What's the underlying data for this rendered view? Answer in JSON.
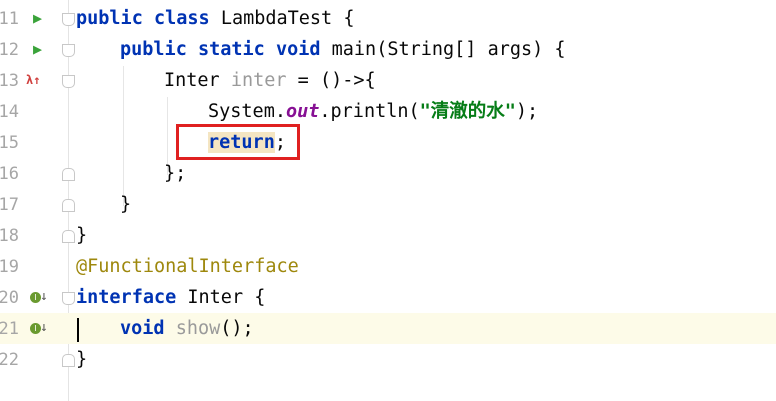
{
  "editor": {
    "lines": [
      {
        "num": "11",
        "text": "public class LambdaTest {"
      },
      {
        "num": "12",
        "text": "public static void main(String[] args) {"
      },
      {
        "num": "13",
        "text": "Inter inter = ()->{"
      },
      {
        "num": "14",
        "text": "System.out.println(\"清澈的水\");"
      },
      {
        "num": "15",
        "text": "return;"
      },
      {
        "num": "16",
        "text": "};"
      },
      {
        "num": "17",
        "text": "}"
      },
      {
        "num": "18",
        "text": "}"
      },
      {
        "num": "19",
        "text": "@FunctionalInterface"
      },
      {
        "num": "20",
        "text": "interface Inter {"
      },
      {
        "num": "21",
        "text": "void show();"
      },
      {
        "num": "22",
        "text": "}"
      }
    ],
    "tokens": {
      "public": "public",
      "class": "class",
      "static": "static",
      "void": "void",
      "interface": "interface",
      "return": "return",
      "lambdatest": "LambdaTest",
      "main": "main",
      "string_args": "(String[] args)",
      "inter_type": "Inter",
      "inter_var": "inter",
      "lambda": " = ()->{",
      "system": "System.",
      "out": "out",
      "println": ".println(",
      "str": "\"清澈的水\"",
      "close_call": ");",
      "anno": "@FunctionalInterface",
      "show": "show",
      "show_parens": "();",
      "brace_open": " {",
      "brace_close": "}",
      "lambda_close": "};",
      "semicolon": ";"
    },
    "gutter_icons": {
      "run": "▶",
      "lambda": "λ↑",
      "impl": "I↓"
    },
    "current_line": "21"
  }
}
